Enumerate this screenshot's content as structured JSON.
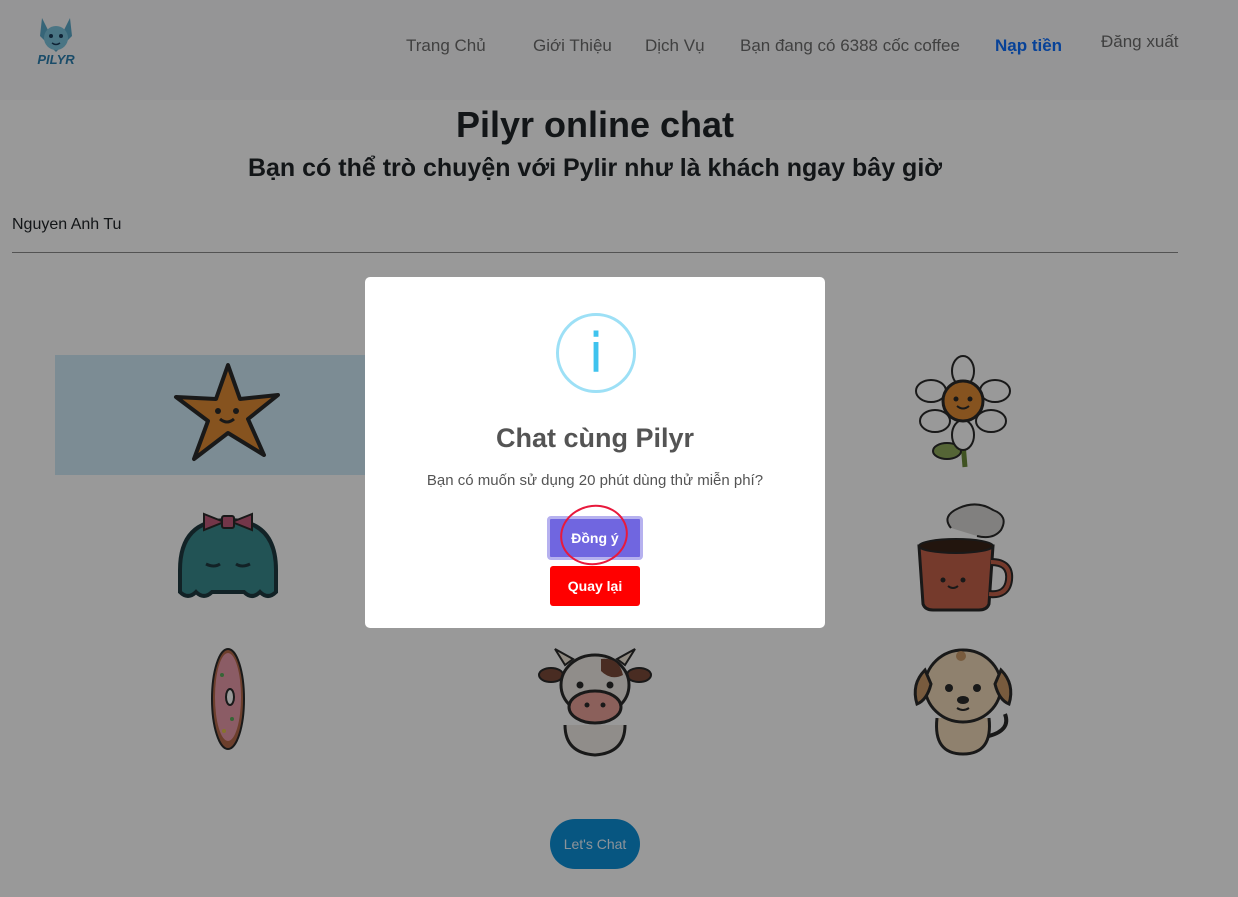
{
  "nav": {
    "brand": "PILYR",
    "items": [
      "Trang Chủ",
      "Giới Thiệu",
      "Dịch Vụ",
      "Bạn đang có 6388 cốc coffee",
      "Nạp tiền",
      "Đăng xuất"
    ]
  },
  "header": {
    "title": "Pilyr online chat",
    "subtitle": "Bạn có thể trò chuyện với Pylir như là khách ngay bây giờ"
  },
  "user": {
    "name": "Nguyen Anh Tu"
  },
  "avatars": [
    "star-icon",
    "flower-icon",
    "ghost-icon",
    "coffee-mug-icon",
    "donut-icon",
    "cow-icon",
    "dog-icon"
  ],
  "chat_button": "Let's Chat",
  "modal": {
    "icon": "i",
    "title": "Chat cùng Pilyr",
    "text": "Bạn có muốn sử dụng 20 phút dùng thử miễn phí?",
    "confirm": "Đồng ý",
    "cancel": "Quay lại"
  },
  "colors": {
    "accent": "#0d6efd",
    "confirm": "#7066e0",
    "cancel": "#ff0000",
    "info": "#3fc3ee"
  }
}
